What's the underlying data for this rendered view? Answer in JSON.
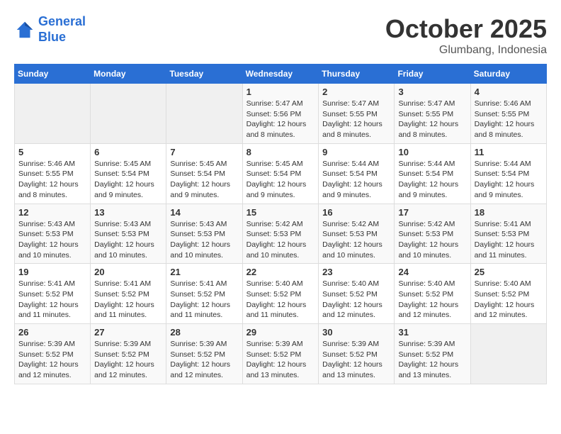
{
  "logo": {
    "line1": "General",
    "line2": "Blue"
  },
  "title": "October 2025",
  "subtitle": "Glumbang, Indonesia",
  "days_of_week": [
    "Sunday",
    "Monday",
    "Tuesday",
    "Wednesday",
    "Thursday",
    "Friday",
    "Saturday"
  ],
  "weeks": [
    [
      {
        "day": "",
        "info": ""
      },
      {
        "day": "",
        "info": ""
      },
      {
        "day": "",
        "info": ""
      },
      {
        "day": "1",
        "info": "Sunrise: 5:47 AM\nSunset: 5:56 PM\nDaylight: 12 hours\nand 8 minutes."
      },
      {
        "day": "2",
        "info": "Sunrise: 5:47 AM\nSunset: 5:55 PM\nDaylight: 12 hours\nand 8 minutes."
      },
      {
        "day": "3",
        "info": "Sunrise: 5:47 AM\nSunset: 5:55 PM\nDaylight: 12 hours\nand 8 minutes."
      },
      {
        "day": "4",
        "info": "Sunrise: 5:46 AM\nSunset: 5:55 PM\nDaylight: 12 hours\nand 8 minutes."
      }
    ],
    [
      {
        "day": "5",
        "info": "Sunrise: 5:46 AM\nSunset: 5:55 PM\nDaylight: 12 hours\nand 8 minutes."
      },
      {
        "day": "6",
        "info": "Sunrise: 5:45 AM\nSunset: 5:54 PM\nDaylight: 12 hours\nand 9 minutes."
      },
      {
        "day": "7",
        "info": "Sunrise: 5:45 AM\nSunset: 5:54 PM\nDaylight: 12 hours\nand 9 minutes."
      },
      {
        "day": "8",
        "info": "Sunrise: 5:45 AM\nSunset: 5:54 PM\nDaylight: 12 hours\nand 9 minutes."
      },
      {
        "day": "9",
        "info": "Sunrise: 5:44 AM\nSunset: 5:54 PM\nDaylight: 12 hours\nand 9 minutes."
      },
      {
        "day": "10",
        "info": "Sunrise: 5:44 AM\nSunset: 5:54 PM\nDaylight: 12 hours\nand 9 minutes."
      },
      {
        "day": "11",
        "info": "Sunrise: 5:44 AM\nSunset: 5:54 PM\nDaylight: 12 hours\nand 9 minutes."
      }
    ],
    [
      {
        "day": "12",
        "info": "Sunrise: 5:43 AM\nSunset: 5:53 PM\nDaylight: 12 hours\nand 10 minutes."
      },
      {
        "day": "13",
        "info": "Sunrise: 5:43 AM\nSunset: 5:53 PM\nDaylight: 12 hours\nand 10 minutes."
      },
      {
        "day": "14",
        "info": "Sunrise: 5:43 AM\nSunset: 5:53 PM\nDaylight: 12 hours\nand 10 minutes."
      },
      {
        "day": "15",
        "info": "Sunrise: 5:42 AM\nSunset: 5:53 PM\nDaylight: 12 hours\nand 10 minutes."
      },
      {
        "day": "16",
        "info": "Sunrise: 5:42 AM\nSunset: 5:53 PM\nDaylight: 12 hours\nand 10 minutes."
      },
      {
        "day": "17",
        "info": "Sunrise: 5:42 AM\nSunset: 5:53 PM\nDaylight: 12 hours\nand 10 minutes."
      },
      {
        "day": "18",
        "info": "Sunrise: 5:41 AM\nSunset: 5:53 PM\nDaylight: 12 hours\nand 11 minutes."
      }
    ],
    [
      {
        "day": "19",
        "info": "Sunrise: 5:41 AM\nSunset: 5:52 PM\nDaylight: 12 hours\nand 11 minutes."
      },
      {
        "day": "20",
        "info": "Sunrise: 5:41 AM\nSunset: 5:52 PM\nDaylight: 12 hours\nand 11 minutes."
      },
      {
        "day": "21",
        "info": "Sunrise: 5:41 AM\nSunset: 5:52 PM\nDaylight: 12 hours\nand 11 minutes."
      },
      {
        "day": "22",
        "info": "Sunrise: 5:40 AM\nSunset: 5:52 PM\nDaylight: 12 hours\nand 11 minutes."
      },
      {
        "day": "23",
        "info": "Sunrise: 5:40 AM\nSunset: 5:52 PM\nDaylight: 12 hours\nand 12 minutes."
      },
      {
        "day": "24",
        "info": "Sunrise: 5:40 AM\nSunset: 5:52 PM\nDaylight: 12 hours\nand 12 minutes."
      },
      {
        "day": "25",
        "info": "Sunrise: 5:40 AM\nSunset: 5:52 PM\nDaylight: 12 hours\nand 12 minutes."
      }
    ],
    [
      {
        "day": "26",
        "info": "Sunrise: 5:39 AM\nSunset: 5:52 PM\nDaylight: 12 hours\nand 12 minutes."
      },
      {
        "day": "27",
        "info": "Sunrise: 5:39 AM\nSunset: 5:52 PM\nDaylight: 12 hours\nand 12 minutes."
      },
      {
        "day": "28",
        "info": "Sunrise: 5:39 AM\nSunset: 5:52 PM\nDaylight: 12 hours\nand 12 minutes."
      },
      {
        "day": "29",
        "info": "Sunrise: 5:39 AM\nSunset: 5:52 PM\nDaylight: 12 hours\nand 13 minutes."
      },
      {
        "day": "30",
        "info": "Sunrise: 5:39 AM\nSunset: 5:52 PM\nDaylight: 12 hours\nand 13 minutes."
      },
      {
        "day": "31",
        "info": "Sunrise: 5:39 AM\nSunset: 5:52 PM\nDaylight: 12 hours\nand 13 minutes."
      },
      {
        "day": "",
        "info": ""
      }
    ]
  ]
}
